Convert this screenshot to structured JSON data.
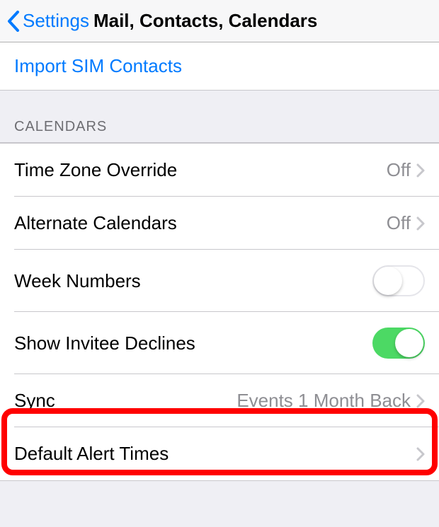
{
  "nav": {
    "back_label": "Settings",
    "title": "Mail, Contacts, Calendars"
  },
  "import_row": {
    "label": "Import SIM Contacts"
  },
  "calendars_section": {
    "header": "CALENDARS"
  },
  "cells": {
    "time_zone_override": {
      "label": "Time Zone Override",
      "value": "Off"
    },
    "alternate_calendars": {
      "label": "Alternate Calendars",
      "value": "Off"
    },
    "week_numbers": {
      "label": "Week Numbers"
    },
    "show_invitee_declines": {
      "label": "Show Invitee Declines"
    },
    "sync": {
      "label": "Sync",
      "value": "Events 1 Month Back"
    },
    "default_alert_times": {
      "label": "Default Alert Times"
    }
  }
}
